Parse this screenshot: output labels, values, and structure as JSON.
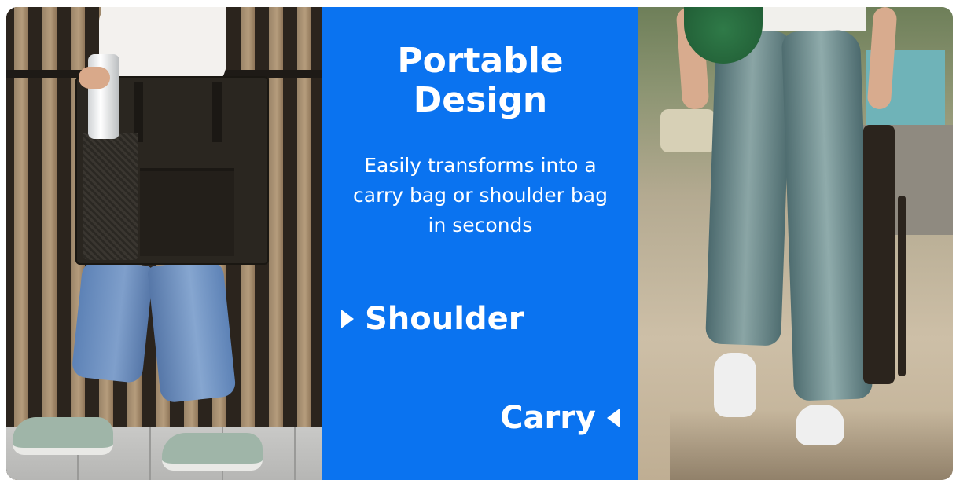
{
  "panel": {
    "title_line1": "Portable",
    "title_line2": "Design",
    "subtitle_line1": "Easily transforms into a",
    "subtitle_line2": "carry bag or shoulder bag",
    "subtitle_line3": "in seconds",
    "label_shoulder": "Shoulder",
    "label_carry": "Carry"
  },
  "icons": {
    "shoulder_marker": "triangle-right-icon",
    "carry_marker": "triangle-left-icon"
  },
  "colors": {
    "panel_background": "#0a73f0",
    "text": "#ffffff"
  }
}
